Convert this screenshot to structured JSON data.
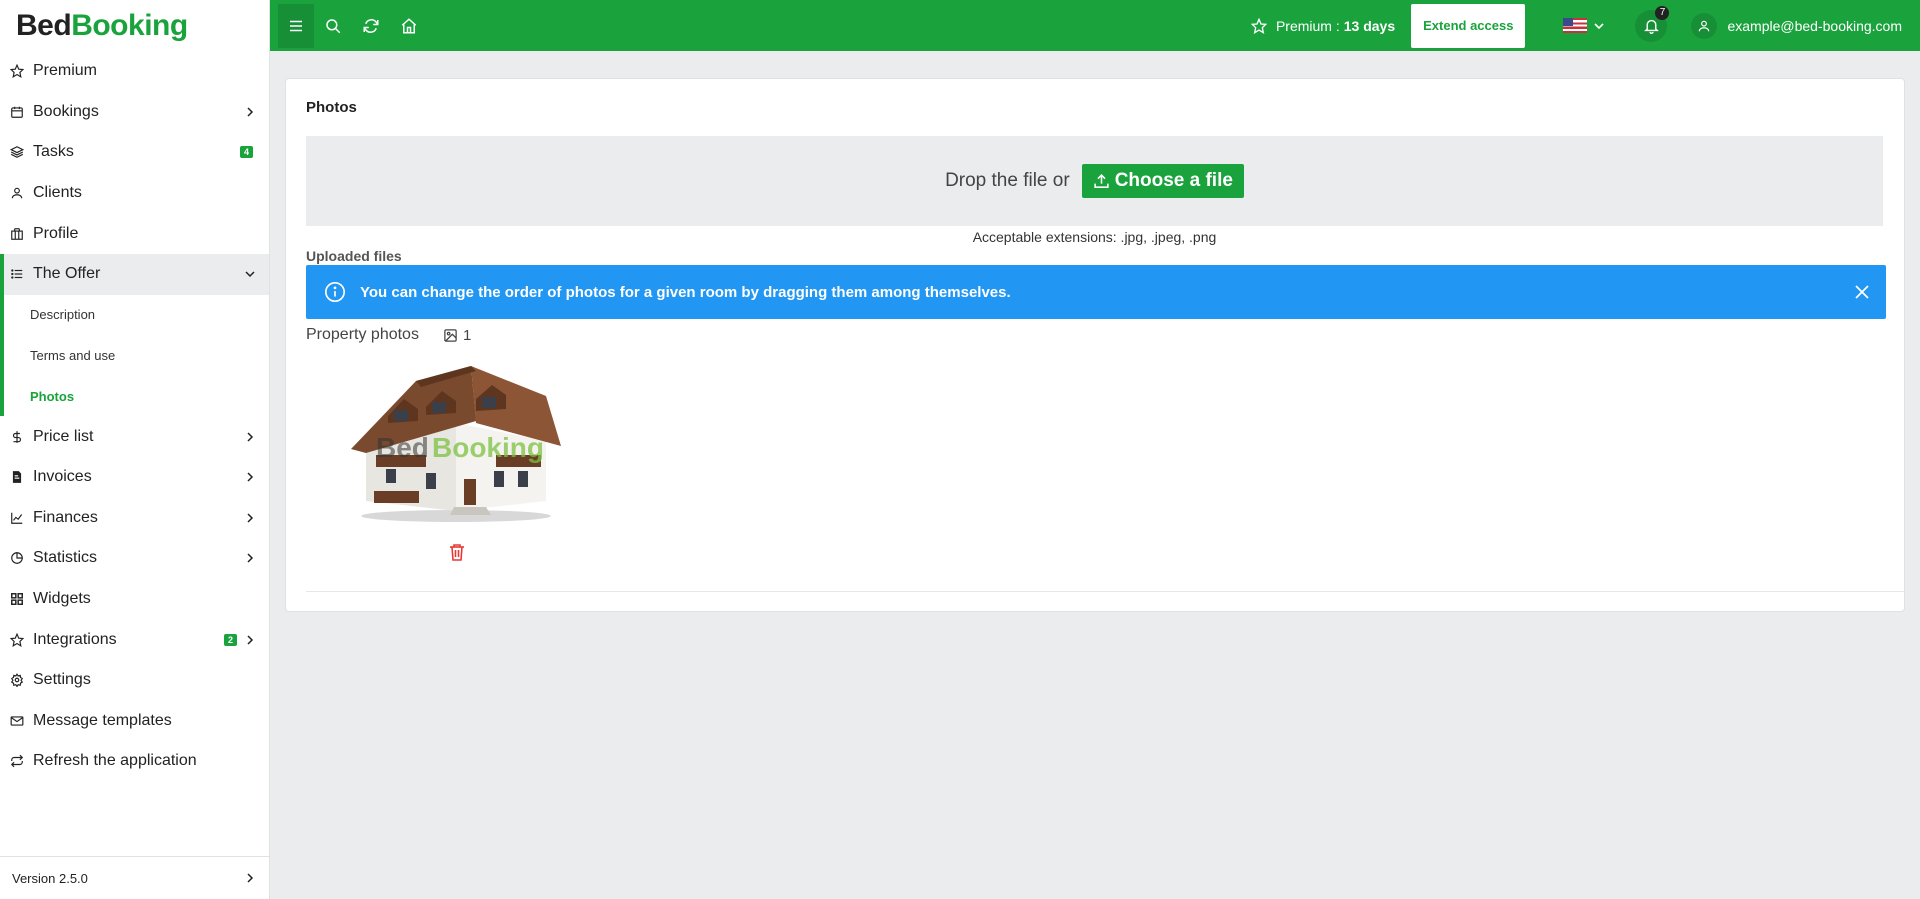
{
  "logo": {
    "part1": "Bed",
    "part2": "Booking"
  },
  "sidebar": {
    "items": [
      {
        "label": "Premium"
      },
      {
        "label": "Bookings"
      },
      {
        "label": "Tasks",
        "badge": "4"
      },
      {
        "label": "Clients"
      },
      {
        "label": "Profile"
      },
      {
        "label": "The Offer"
      },
      {
        "label": "Price list"
      },
      {
        "label": "Invoices"
      },
      {
        "label": "Finances"
      },
      {
        "label": "Statistics"
      },
      {
        "label": "Widgets"
      },
      {
        "label": "Integrations",
        "badge": "2"
      },
      {
        "label": "Settings"
      },
      {
        "label": "Message templates"
      },
      {
        "label": "Refresh the application"
      }
    ],
    "offer_subitems": [
      {
        "label": "Description"
      },
      {
        "label": "Terms and use"
      },
      {
        "label": "Photos"
      }
    ],
    "version": "Version 2.5.0"
  },
  "topbar": {
    "premium_label": "Premium :",
    "premium_days": "13 days",
    "extend_label": "Extend access",
    "notifications_count": "7",
    "user_email": "example@bed-booking.com"
  },
  "main": {
    "title": "Photos",
    "drop_text": "Drop the file or",
    "choose_label": "Choose a file",
    "extensions_note": "Acceptable extensions: .jpg, .jpeg, .png",
    "uploaded_label": "Uploaded files",
    "alert_text": "You can change the order of photos for a given room by dragging them among themselves.",
    "property_photos_label": "Property photos",
    "photo_count": "1",
    "photo_watermark": {
      "part1": "Bed",
      "part2": "Booking"
    }
  },
  "colors": {
    "brand_green": "#1aa33d",
    "info_blue": "#2196f3",
    "delete_red": "#e53935"
  }
}
